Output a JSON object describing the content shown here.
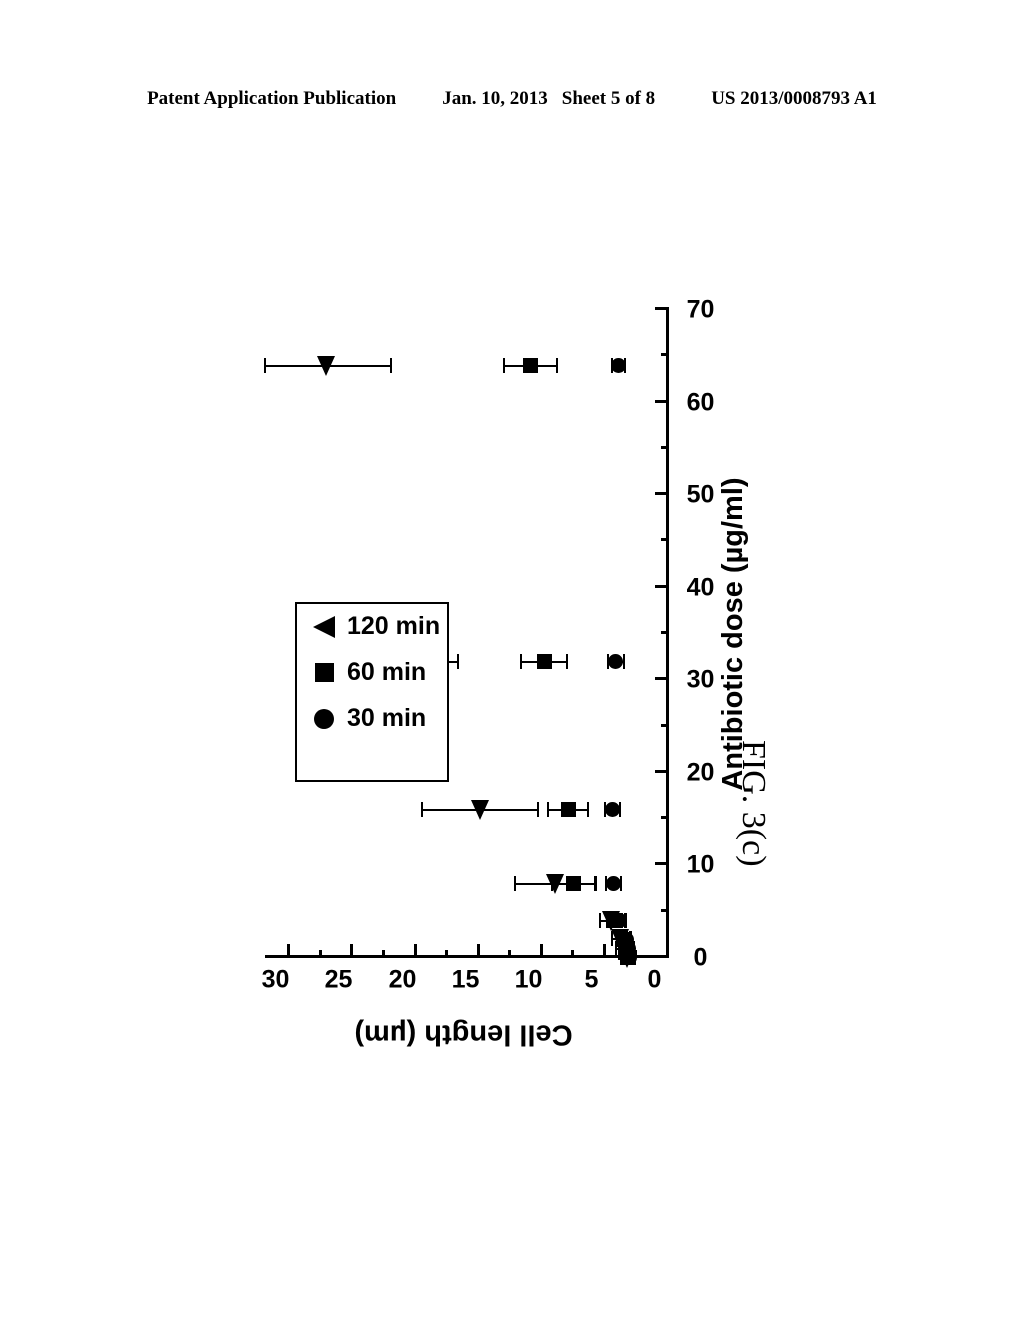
{
  "header": {
    "publication_label": "Patent Application Publication",
    "date": "Jan. 10, 2013",
    "sheet": "Sheet 5 of 8",
    "patent_number": "US 2013/0008793 A1"
  },
  "figure": {
    "caption": "FIG. 3(c)"
  },
  "legend": {
    "entries": [
      {
        "label": "120 min",
        "marker": "triangle-marker"
      },
      {
        "label": "60 min",
        "marker": "square-marker"
      },
      {
        "label": "30 min",
        "marker": "circle-marker"
      }
    ]
  },
  "chart_data": {
    "type": "scatter",
    "title": "FIG. 3(c)",
    "xlabel": "Antibiotic dose (µg/ml)",
    "ylabel": "Cell length (µm)",
    "xlim": [
      0,
      70
    ],
    "ylim": [
      0,
      32
    ],
    "xticks": [
      0,
      10,
      20,
      30,
      40,
      50,
      60,
      70
    ],
    "xticks_minor": [
      5,
      15,
      25,
      35,
      45,
      55,
      65
    ],
    "yticks": [
      0,
      5,
      10,
      15,
      20,
      25,
      30
    ],
    "yticks_minor": [
      2.5,
      7.5,
      12.5,
      17.5,
      22.5,
      27.5
    ],
    "xtick_labels": [
      "0",
      "10",
      "20",
      "30",
      "40",
      "50",
      "60",
      "70"
    ],
    "ytick_labels": [
      "0",
      "5",
      "10",
      "15",
      "20",
      "25",
      "30"
    ],
    "grid": false,
    "legend_position": "upper-left",
    "orientation": "rotated-90-ccw",
    "error_bars": "symmetric-x-of-rotated-axis",
    "series": [
      {
        "name": "120 min",
        "marker": "triangle",
        "points": [
          {
            "x": 0,
            "y": 3.3,
            "yerr": 0.5
          },
          {
            "x": 0.5,
            "y": 3.5,
            "yerr": 0.5
          },
          {
            "x": 1,
            "y": 3.6,
            "yerr": 0.6
          },
          {
            "x": 2,
            "y": 3.9,
            "yerr": 0.6
          },
          {
            "x": 4,
            "y": 4.6,
            "yerr": 0.9
          },
          {
            "x": 8,
            "y": 9.0,
            "yerr": 3.2
          },
          {
            "x": 16,
            "y": 15.0,
            "yerr": 4.6
          },
          {
            "x": 32,
            "y": 22.2,
            "yerr": 5.5
          },
          {
            "x": 64,
            "y": 27.2,
            "yerr": 5.2
          }
        ]
      },
      {
        "name": "60 min",
        "marker": "square",
        "points": [
          {
            "x": 0,
            "y": 3.2,
            "yerr": 0.4
          },
          {
            "x": 0.5,
            "y": 3.3,
            "yerr": 0.4
          },
          {
            "x": 1,
            "y": 3.4,
            "yerr": 0.5
          },
          {
            "x": 2,
            "y": 3.6,
            "yerr": 0.5
          },
          {
            "x": 4,
            "y": 4.2,
            "yerr": 0.7
          },
          {
            "x": 8,
            "y": 7.6,
            "yerr": 1.7
          },
          {
            "x": 16,
            "y": 8.0,
            "yerr": 1.6
          },
          {
            "x": 32,
            "y": 9.9,
            "yerr": 1.8
          },
          {
            "x": 64,
            "y": 11.0,
            "yerr": 2.1
          }
        ]
      },
      {
        "name": "30 min",
        "marker": "circle",
        "points": [
          {
            "x": 0,
            "y": 3.1,
            "yerr": 0.3
          },
          {
            "x": 0.5,
            "y": 3.2,
            "yerr": 0.3
          },
          {
            "x": 1,
            "y": 3.2,
            "yerr": 0.4
          },
          {
            "x": 2,
            "y": 3.4,
            "yerr": 0.4
          },
          {
            "x": 4,
            "y": 3.9,
            "yerr": 0.5
          },
          {
            "x": 8,
            "y": 4.4,
            "yerr": 0.6
          },
          {
            "x": 16,
            "y": 4.5,
            "yerr": 0.6
          },
          {
            "x": 32,
            "y": 4.2,
            "yerr": 0.6
          },
          {
            "x": 64,
            "y": 4.0,
            "yerr": 0.5
          }
        ]
      }
    ]
  }
}
